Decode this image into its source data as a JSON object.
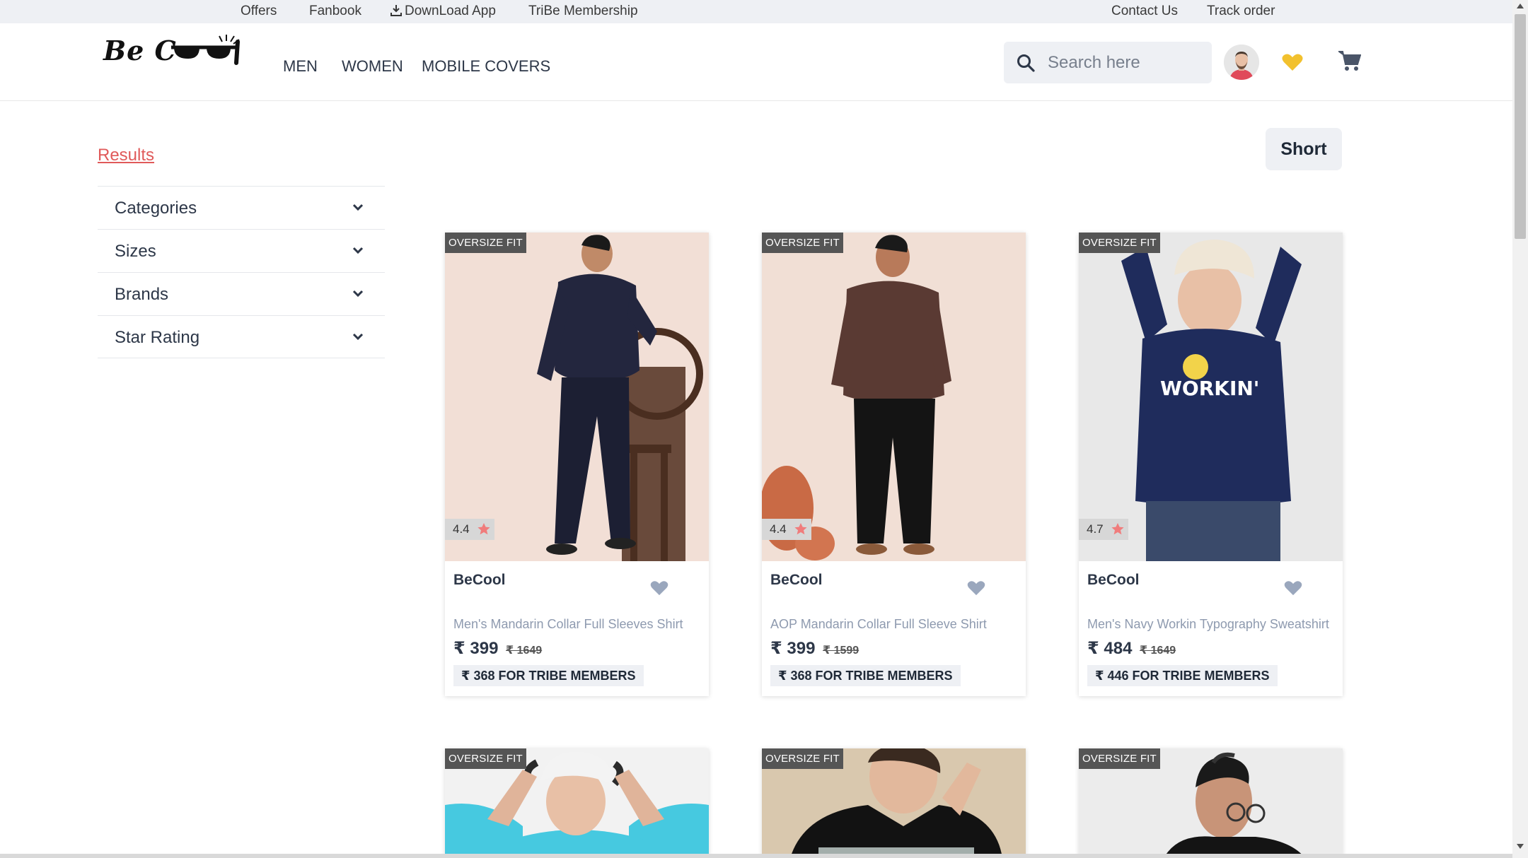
{
  "topbar": {
    "offers": "Offers",
    "fanbook": "Fanbook",
    "download_app": "DownLoad App",
    "tribe": "TriBe Membership",
    "contact": "Contact Us",
    "track": "Track order"
  },
  "header": {
    "logo_text": "Be C",
    "nav": [
      "MEN",
      "WOMEN",
      "MOBILE COVERS"
    ],
    "search_placeholder": "Search here"
  },
  "sidebar": {
    "results_label": "Results",
    "filters": [
      "Categories",
      "Sizes",
      "Brands",
      "Star Rating"
    ]
  },
  "sort_label": "Short",
  "products": [
    {
      "badge": "OVERSIZE FIT",
      "rating": "4.4",
      "brand": "BeCool",
      "name": "Men's Mandarin Collar Full Sleeves Shirt",
      "price": "₹ 399",
      "mrp": "₹ 1649",
      "tribe": "₹ 368 FOR TRIBE MEMBERS",
      "bg": "#f2dfd6"
    },
    {
      "badge": "OVERSIZE FIT",
      "rating": "4.4",
      "brand": "BeCool",
      "name": "AOP Mandarin Collar Full Sleeve Shirt",
      "price": "₹ 399",
      "mrp": "₹ 1599",
      "tribe": "₹ 368 FOR TRIBE MEMBERS",
      "bg": "#f1dfd5"
    },
    {
      "badge": "OVERSIZE FIT",
      "rating": "4.7",
      "brand": "BeCool",
      "name": "Men's Navy Workin Typography Sweatshirt",
      "price": "₹ 484",
      "mrp": "₹ 1649",
      "tribe": "₹ 446 FOR TRIBE MEMBERS",
      "bg": "#e8e8e8"
    },
    {
      "badge": "OVERSIZE FIT",
      "bg": "#f2f2f2"
    },
    {
      "badge": "OVERSIZE FIT",
      "bg": "#d9c8ae"
    },
    {
      "badge": "OVERSIZE FIT",
      "bg": "#ececec"
    }
  ],
  "colors": {
    "accent_red": "#e05a5a",
    "heart_yellow": "#f2c12e",
    "star_red": "#f07c7c"
  }
}
